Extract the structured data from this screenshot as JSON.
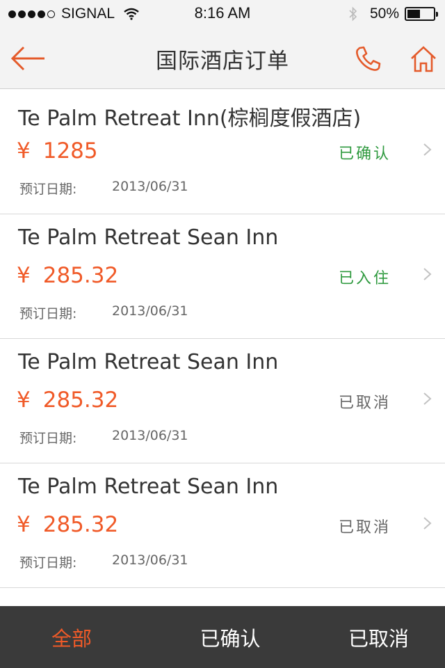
{
  "status_bar": {
    "carrier": "SIGNAL",
    "time": "8:16 AM",
    "battery": "50%",
    "battery_level": 0.5
  },
  "nav": {
    "title": "国际酒店订单",
    "back_icon": "back-arrow-icon",
    "phone_icon": "phone-icon",
    "home_icon": "home-icon"
  },
  "orders": [
    {
      "name": "Te Palm Retreat Inn(棕榈度假酒店)",
      "currency": "¥",
      "price": "1285",
      "status": "已确认",
      "date_label": "预订日期:",
      "date": "2013/06/31"
    },
    {
      "name": "Te Palm Retreat Sean Inn",
      "currency": "¥",
      "price": "285.32",
      "status": "已入住",
      "date_label": "预订日期:",
      "date": "2013/06/31"
    },
    {
      "name": "Te Palm Retreat Sean Inn",
      "currency": "¥",
      "price": "285.32",
      "status": "已取消",
      "date_label": "预订日期:",
      "date": "2013/06/31"
    },
    {
      "name": "Te Palm Retreat Sean Inn",
      "currency": "¥",
      "price": "285.32",
      "status": "已取消",
      "date_label": "预订日期:",
      "date": "2013/06/31"
    }
  ],
  "tabs": [
    {
      "label": "全部",
      "active": true
    },
    {
      "label": "已确认",
      "active": false
    },
    {
      "label": "已取消",
      "active": false
    }
  ],
  "colors": {
    "accent": "#f05a28",
    "status_green": "#2f9a3f",
    "status_gray": "#666666",
    "tab_bar_bg": "#3a3a3a"
  }
}
